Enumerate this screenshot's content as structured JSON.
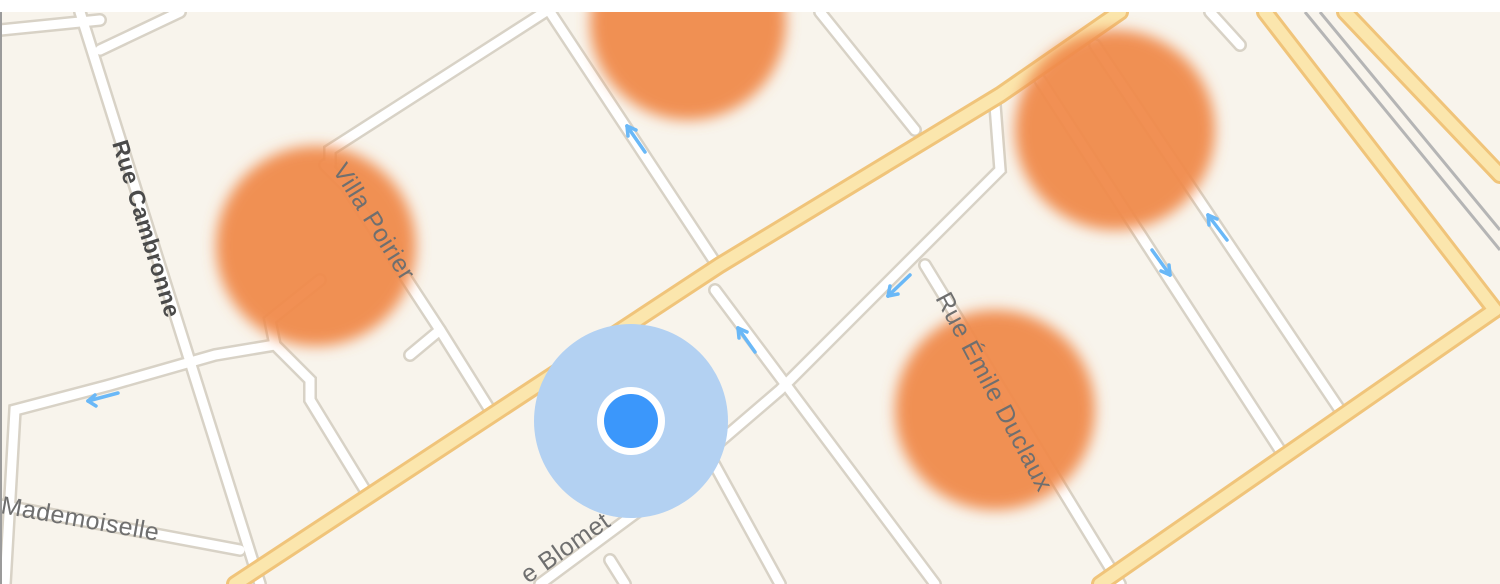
{
  "map": {
    "streets": [
      {
        "id": "rue-cambronne",
        "name": "Rue Cambronne"
      },
      {
        "id": "villa-poirier",
        "name": "Villa Poirier"
      },
      {
        "id": "rue-emile-duclaux",
        "name": "Rue Émile Duclaux"
      },
      {
        "id": "rue-blomet",
        "name": "e Blomet"
      },
      {
        "id": "rue-mademoiselle",
        "name": "Mademoiselle"
      }
    ],
    "hotspot_count": 4,
    "colors": {
      "background": "#f8f4ec",
      "minor_road": "#ffffff",
      "minor_road_edge": "#d9d3c8",
      "major_road": "#fbe4a6",
      "major_road_edge": "#f1c67c",
      "hotspot": "#f08a4b",
      "one_way_arrow": "#6ab8f7",
      "location_dot": "#3b97fb",
      "location_halo": "#b3d1f2",
      "railway": "#b7b7b7"
    },
    "icons": [
      "one-way-arrow-icon",
      "current-location-icon"
    ]
  }
}
